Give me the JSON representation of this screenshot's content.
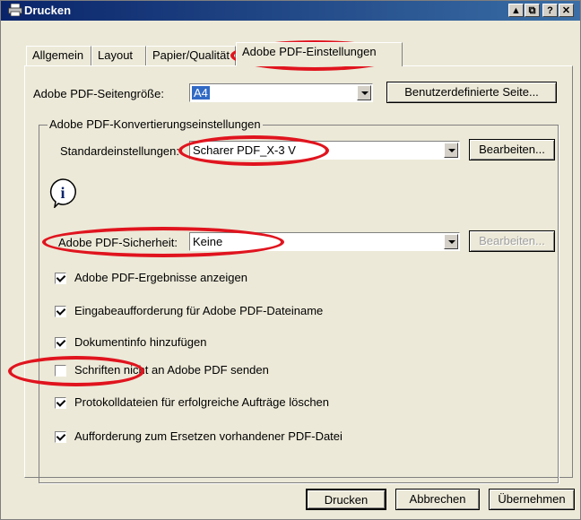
{
  "window": {
    "title": "Drucken",
    "controls": [
      "▲",
      "⧉",
      "?",
      "✕"
    ]
  },
  "tabs": [
    {
      "label": "Allgemein",
      "active": false
    },
    {
      "label": "Layout",
      "active": false
    },
    {
      "label": "Papier/Qualität",
      "active": false
    },
    {
      "label": "Adobe PDF-Einstellungen",
      "active": true
    }
  ],
  "page_size": {
    "label": "Adobe PDF-Seitengröße:",
    "value": "A4",
    "custom_button": "Benutzerdefinierte Seite..."
  },
  "conversion": {
    "group_title": "Adobe PDF-Konvertierungseinstellungen",
    "default_label": "Standardeinstellungen:",
    "default_value": "Scharer PDF_X-3 V",
    "edit_button": "Bearbeiten...",
    "security_label": "Adobe PDF-Sicherheit:",
    "security_value": "Keine",
    "security_edit_button": "Bearbeiten..."
  },
  "checkboxes": [
    {
      "label": "Adobe PDF-Ergebnisse anzeigen",
      "checked": true
    },
    {
      "label": "Eingabeaufforderung für Adobe PDF-Dateiname",
      "checked": true
    },
    {
      "label": "Dokumentinfo hinzufügen",
      "checked": true
    },
    {
      "label": "Schriften nicht an Adobe PDF senden",
      "checked": false
    },
    {
      "label": "Protokolldateien für erfolgreiche Aufträge löschen",
      "checked": true
    },
    {
      "label": "Aufforderung zum Ersetzen vorhandener PDF-Datei",
      "checked": true
    }
  ],
  "footer": {
    "print_button": "Drucken",
    "cancel_button": "Abbrechen",
    "apply_button": "Übernehmen"
  },
  "colors": {
    "annotation_red": "#e0141e",
    "title_blue": "#0a246a",
    "dialog_bg": "#ece9d8"
  }
}
